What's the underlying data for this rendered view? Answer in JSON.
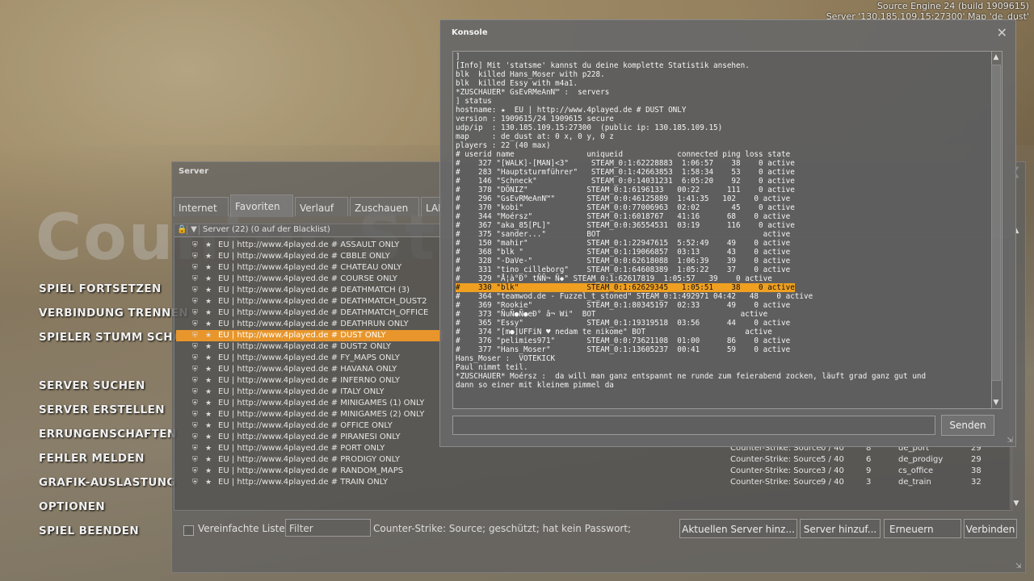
{
  "engine": {
    "build": "Source Engine 24 (build 1909615)",
    "server_line": "Server '130.185.109.15:27300' Map 'de_dust'"
  },
  "logo_text": "Counter-Strike",
  "menu": {
    "items": [
      "SPIEL FORTSETZEN",
      "VERBINDUNG TRENNEN",
      "SPIELER STUMM SCHALTEN",
      "SERVER SUCHEN",
      "SERVER ERSTELLEN",
      "ERRUNGENSCHAFTEN",
      "FEHLER MELDEN",
      "GRAFIK-AUSLASTUNG",
      "OPTIONEN",
      "SPIEL BEENDEN"
    ]
  },
  "server_browser": {
    "title": "Server",
    "tabs": [
      "Internet",
      "Favoriten",
      "Verlauf",
      "Zuschauen",
      "LAN"
    ],
    "header_label": "Server (22) (0 auf der Blacklist)",
    "rows": [
      {
        "name": "EU | http://www.4played.de # ASSAULT ONLY"
      },
      {
        "name": "EU | http://www.4played.de # CBBLE ONLY"
      },
      {
        "name": "EU | http://www.4played.de # CHATEAU ONLY"
      },
      {
        "name": "EU | http://www.4played.de # COURSE ONLY"
      },
      {
        "name": "EU | http://www.4played.de # DEATHMATCH (3)"
      },
      {
        "name": "EU | http://www.4played.de # DEATHMATCH_DUST2"
      },
      {
        "name": "EU | http://www.4played.de # DEATHMATCH_OFFICE"
      },
      {
        "name": "EU | http://www.4played.de # DEATHRUN ONLY"
      },
      {
        "name": "EU | http://www.4played.de # DUST ONLY",
        "selected": true
      },
      {
        "name": "EU | http://www.4played.de # DUST2 ONLY"
      },
      {
        "name": "EU | http://www.4played.de # FY_MAPS ONLY"
      },
      {
        "name": "EU | http://www.4played.de # HAVANA ONLY"
      },
      {
        "name": "EU | http://www.4played.de # INFERNO ONLY"
      },
      {
        "name": "EU | http://www.4played.de # ITALY ONLY"
      },
      {
        "name": "EU | http://www.4played.de # MINIGAMES (1) ONLY"
      },
      {
        "name": "EU | http://www.4played.de # MINIGAMES (2) ONLY"
      },
      {
        "name": "EU | http://www.4played.de # OFFICE ONLY"
      },
      {
        "name": "EU | http://www.4played.de # PIRANESI ONLY"
      },
      {
        "name": "EU | http://www.4played.de # PORT ONLY",
        "game": "Counter-Strike: Source",
        "players": "0 / 40",
        "bots": "8",
        "map": "de_port",
        "latency": "29"
      },
      {
        "name": "EU | http://www.4played.de # PRODIGY ONLY",
        "game": "Counter-Strike: Source",
        "players": "5 / 40",
        "bots": "6",
        "map": "de_prodigy",
        "latency": "29"
      },
      {
        "name": "EU | http://www.4played.de # RANDOM_MAPS",
        "game": "Counter-Strike: Source",
        "players": "3 / 40",
        "bots": "9",
        "map": "cs_office",
        "latency": "38"
      },
      {
        "name": "EU | http://www.4played.de # TRAIN ONLY",
        "game": "Counter-Strike: Source",
        "players": "9 / 40",
        "bots": "3",
        "map": "de_train",
        "latency": "32"
      }
    ],
    "simple_list_label": "Vereinfachte Liste",
    "filter_label": "Filter",
    "filter_desc": "Counter-Strike: Source; geschützt; hat kein Passwort;",
    "buttons": {
      "add_current": "Aktuellen Server hinz...",
      "add_server": "Server hinzuf...",
      "refresh": "Erneuern",
      "connect": "Verbinden"
    }
  },
  "console": {
    "title": "Konsole",
    "send_label": "Senden",
    "input_value": "",
    "lines": [
      "]",
      "[Info] Mit 'statsme' kannst du deine komplette Statistik ansehen.",
      "blk  killed Hans_Moser with p228.",
      "blk  killed Essy with m4a1.",
      "*ZUSCHAUER* GsEvRMeAnN™ :  servers",
      "] status",
      "hostname: ★  EU | http://www.4played.de # DUST ONLY",
      "version : 1909615/24 1909615 secure",
      "udp/ip  : 130.185.109.15:27300  (public ip: 130.185.109.15)",
      "map     : de_dust at: 0 x, 0 y, 0 z",
      "players : 22 (40 max)",
      "",
      "# userid name                uniqueid            connected ping loss state",
      "#    327 \"[WALK]-[MAN]<3\"     STEAM_0:1:62228883  1:06:57    38    0 active",
      "#    283 \"Hauptsturmführer\"   STEAM_0:1:42663853  1:58:34    53    0 active",
      "#    146 \"Schneck\"            STEAM_0:0:14031231  6:05:20    92    0 active",
      "#    378 \"DÖNIZ\"             STEAM_0:1:6196133   00:22      111    0 active",
      "#    296 \"GsEvRMeAnN™\"       STEAM_0:0:46125889  1:41:35   102    0 active",
      "#    370 \"kobi\"              STEAM_0:0:77006963  02:02       45    0 active",
      "#    344 \"Moérsz\"            STEAM_0:1:6018767   41:16      68    0 active",
      "#    367 \"aka_85[PL]\"        STEAM_0:0:36554531  03:19      116    0 active",
      "#    375 \"sander...\"         BOT                                    active",
      "#    150 \"mahir\"             STEAM_0:1:22947615  5:52:49    49    0 active",
      "#    368 \"blk \"              STEAM_0:1:19066857  03:13      43    0 active",
      "#    328 \"-DaVe-\"            STEAM_0:0:62618088  1:06:39    39    0 active",
      "#    331 \"tino_cilleborg\"    STEAM_0:1:64608389  1:05:22    37    0 active",
      "#    329 \"Å¦à°Ð° tÑÑ¬ Ñ◆\" STEAM_0:1:62617819  1:05:57   39    0 active",
      "#    330 \"blk\"               STEAM_0:1:62629345   1:05:51    38    0 active",
      "#    364 \"teamwod.de - Fuzzel_t_stoned\" STEAM_0:1:492971 04:42   48    0 active",
      "#    369 \"Rookie\"            STEAM_0:1:80345197  02:33      49    0 active",
      "#    373 \"ÑuÑ●Ñ●eÐ° â¬ Wi\"  BOT                                active",
      "#    365 \"Essy\"              STEAM_0:1:19319518  03:56      44    0 active",
      "#    374 \"[m●]UFFiN ♥ nedam te nikome\" BOT                      active",
      "#    376 \"pelimies971\"       STEAM_0:0:73621108  01:00      86    0 active",
      "#    377 \"Hans_Moser\"        STEAM_0:1:13605237  00:41      59    0 active",
      "Hans_Moser :  VOTEKICK",
      "Paul nimmt teil.",
      "*ZUSCHAUER* Moérsz :  da will man ganz entspannt ne runde zum feierabend zocken, läuft grad ganz gut und",
      "dann so einer mit kleinem pimmel da"
    ],
    "highlight_index": 27
  }
}
